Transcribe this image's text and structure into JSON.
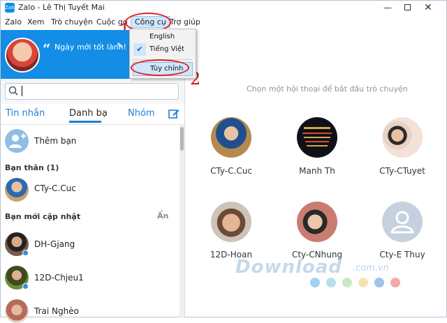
{
  "window": {
    "title": "Zalo - Lê Thị Tuyết Mai",
    "app_logo_text": "Zalo",
    "controls": [
      "minimize",
      "maximize",
      "close"
    ]
  },
  "menu": {
    "items": [
      "Zalo",
      "Xem",
      "Trò chuyện",
      "Cuộc gọ",
      "Công cụ",
      "Trợ giúp"
    ],
    "active": "Công cụ"
  },
  "dropdown": {
    "items": [
      {
        "label": "English",
        "checked": false
      },
      {
        "label": "Tiếng Việt",
        "checked": true
      },
      {
        "label": "Tùy chỉnh",
        "highlighted": true
      }
    ]
  },
  "annotations": {
    "marker_1": "1",
    "marker_2": "2",
    "color": "#e01f26"
  },
  "profile": {
    "status": "Ngày mới tốt lành!",
    "quote": "“",
    "background_color": "#138de6"
  },
  "tabs": [
    {
      "label": "Tin nhắn",
      "active": false
    },
    {
      "label": "Danh bạ",
      "active": true
    },
    {
      "label": "Nhóm",
      "active": false
    }
  ],
  "contacts": {
    "add_friend": "Thêm bạn",
    "sections": [
      {
        "title": "Bạn thân (1)",
        "items": [
          "CTy-C.Cuc"
        ]
      },
      {
        "title": "Bạn mới cập nhật",
        "hide_label": "Ẩn",
        "items": [
          "DH-Gjang",
          "12D-Chjeu1",
          "Trai Nghèo"
        ]
      }
    ]
  },
  "main": {
    "hint": "Chọn một hội thoại để bắt đầu trò chuyện",
    "recent": [
      "CTy-C.Cuc",
      "Manh Th",
      "CTy-CTuyet",
      "12D-Hoan",
      "Cty-CNhung",
      "Cty-E Thuy"
    ]
  },
  "watermark": {
    "text": "Download",
    "suffix": ".com.vn",
    "dot_colors": [
      "#9fd3f2",
      "#b6e0f0",
      "#c9e8c3",
      "#f7e3b0",
      "#f7c9a6",
      "#9fc3ea",
      "#f3a9a9"
    ]
  },
  "colors": {
    "accent": "#1f7fd4",
    "header_blue": "#138de6",
    "online": "#2f8fe4"
  }
}
